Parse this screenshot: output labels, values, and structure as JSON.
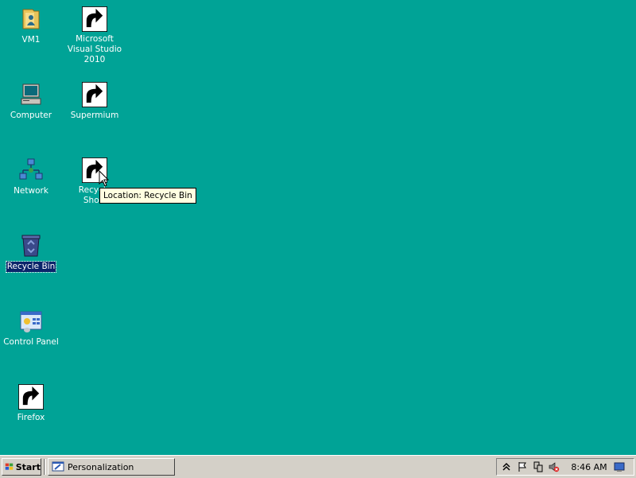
{
  "desktop": {
    "background_color": "#00a396",
    "icons": [
      {
        "label": "VM1",
        "icon": "folder-user-icon"
      },
      {
        "label": "Microsoft Visual Studio 2010",
        "icon": "visual-studio-icon"
      },
      {
        "label": "Computer",
        "icon": "computer-icon"
      },
      {
        "label": "Supermium",
        "icon": "supermium-browser-icon"
      },
      {
        "label": "Network",
        "icon": "network-icon"
      },
      {
        "label": "Recycle Bin Shortcut",
        "label_visible": "Recycle\nShort",
        "icon": "recycle-bin-full-icon"
      },
      {
        "label": "Recycle Bin",
        "icon": "recycle-bin-icon"
      },
      {
        "label": "Control Panel",
        "icon": "control-panel-icon"
      },
      {
        "label": "Firefox",
        "icon": "firefox-icon"
      }
    ],
    "selected_icon": "Recycle Bin",
    "tooltip": "Location: Recycle Bin"
  },
  "taskbar": {
    "start_label": "Start",
    "tasks": [
      {
        "label": "Personalization",
        "icon": "personalization-icon"
      }
    ],
    "tray": {
      "icons": [
        "chevron-up-icon",
        "flag-icon",
        "network-tray-icon",
        "volume-muted-icon"
      ],
      "clock": "8:46 AM"
    }
  }
}
